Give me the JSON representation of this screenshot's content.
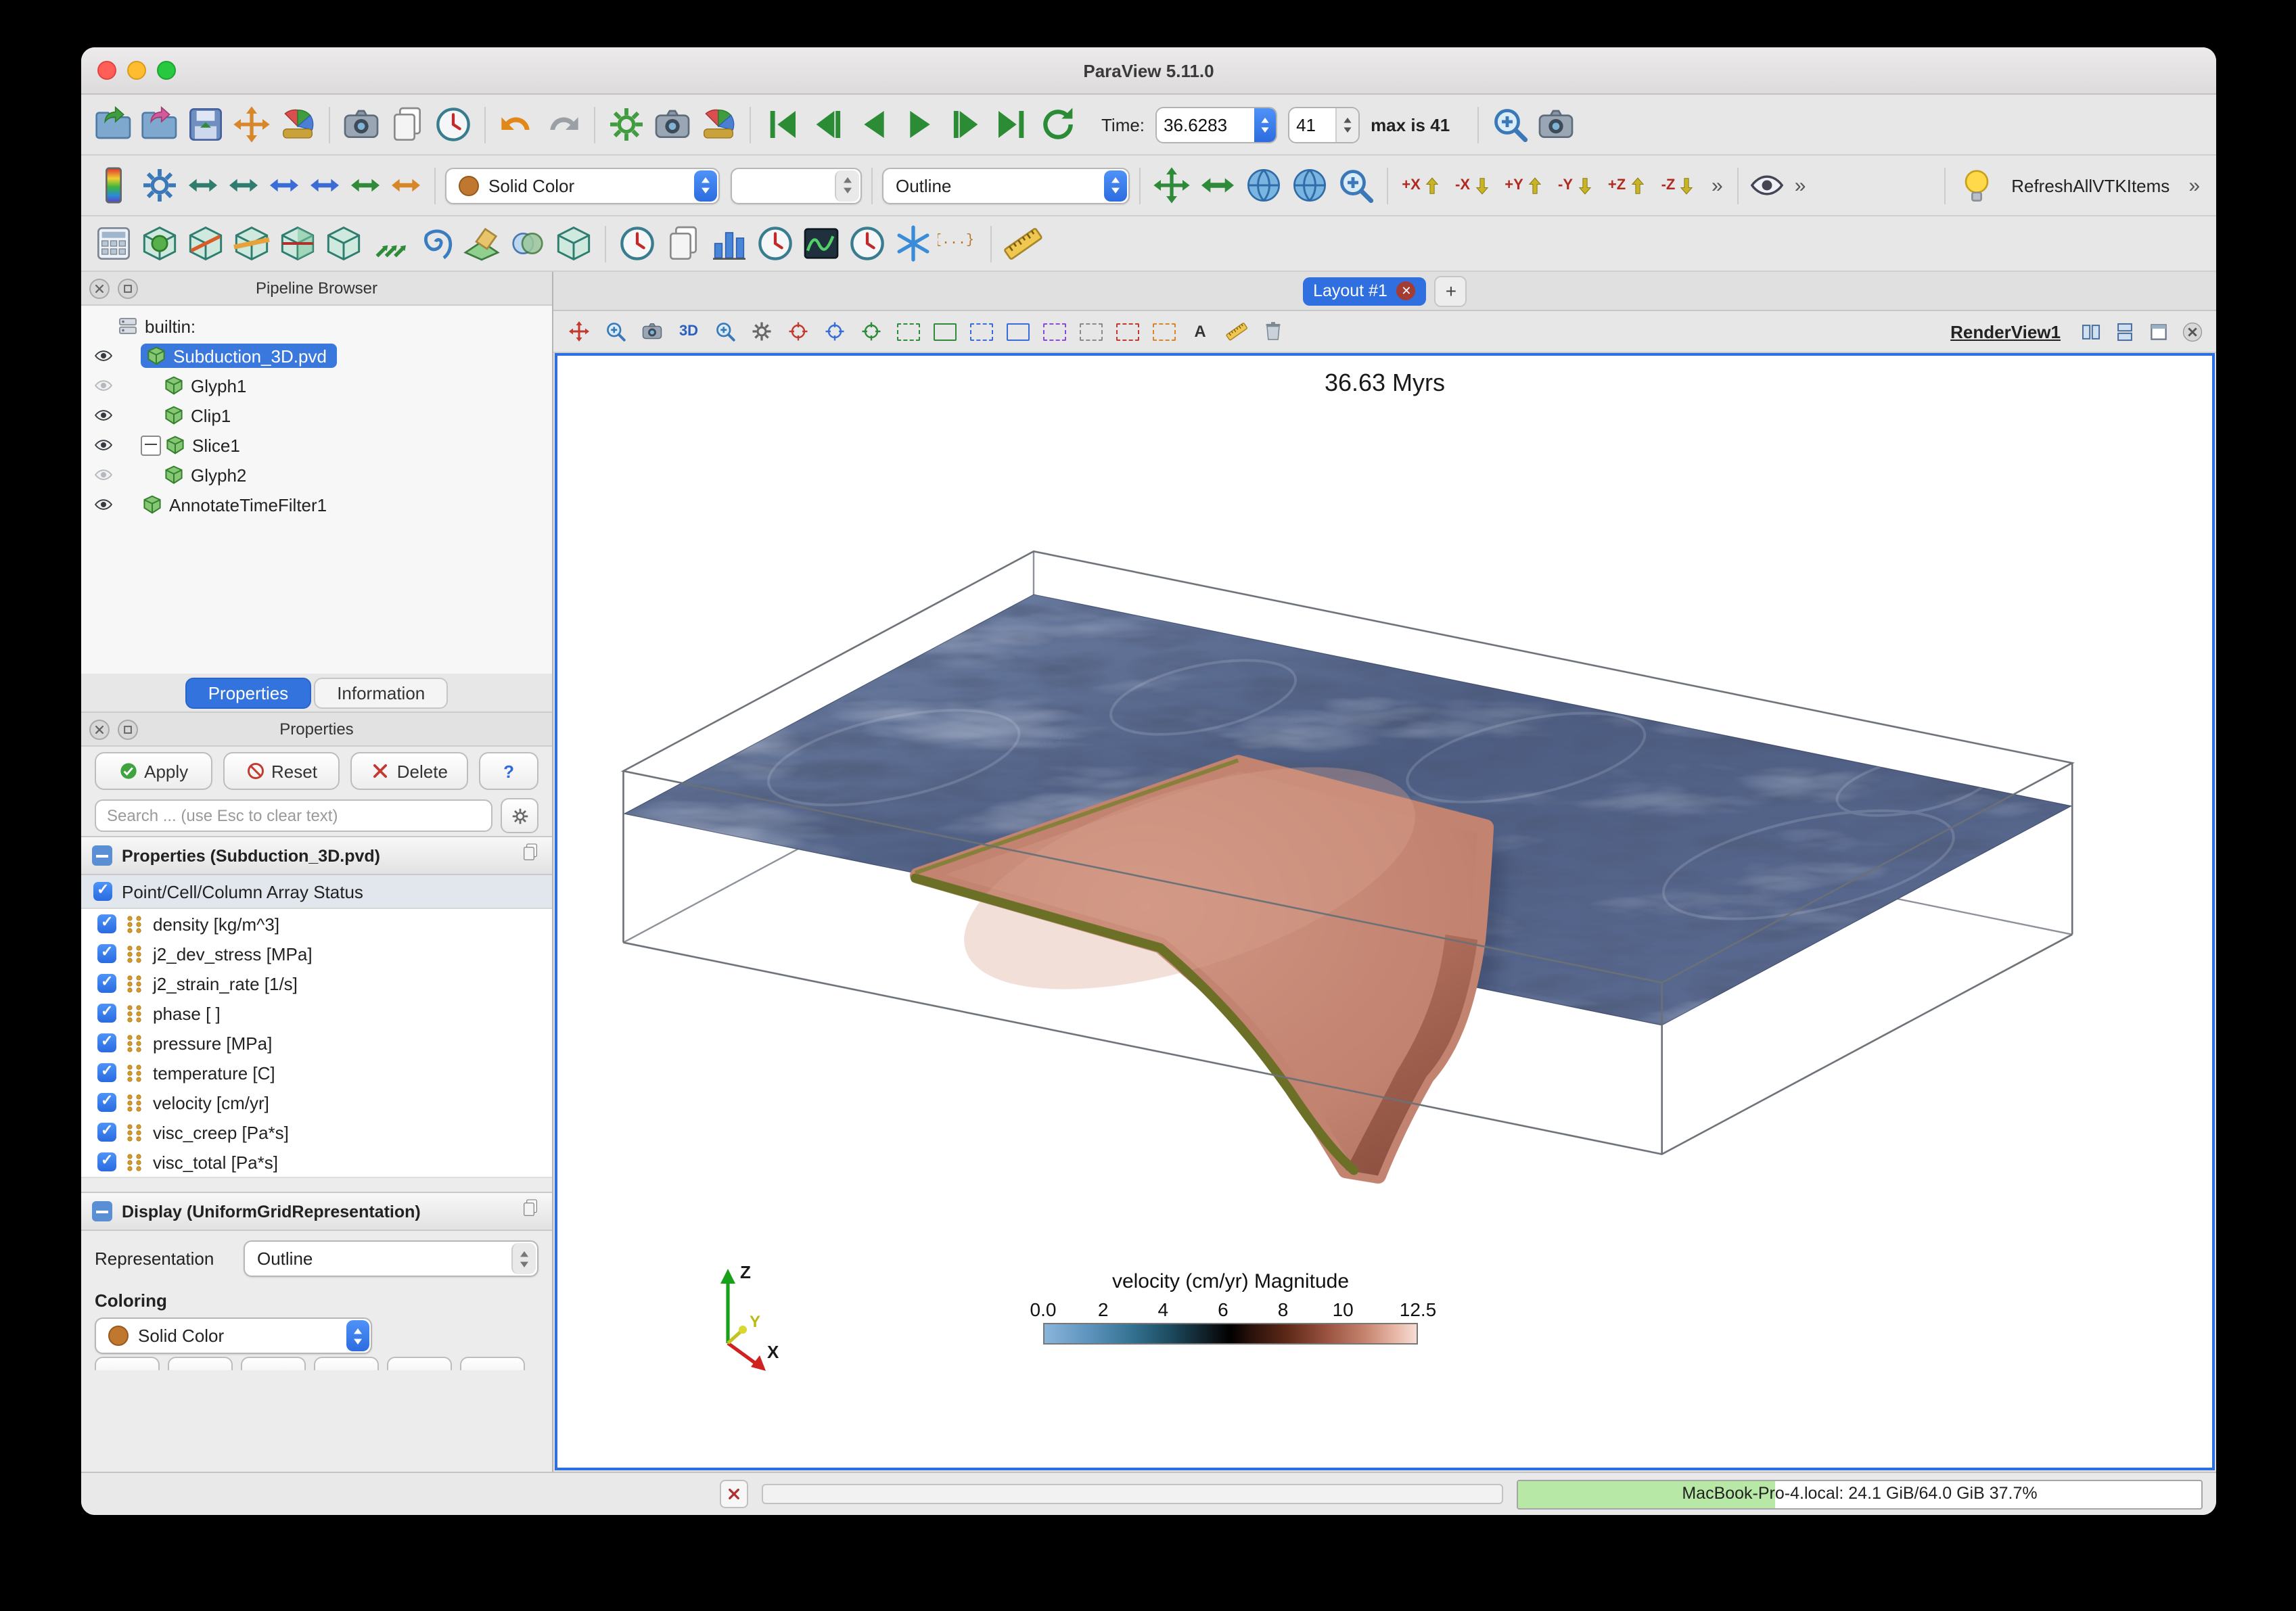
{
  "window": {
    "title": "ParaView 5.11.0"
  },
  "glyphs": {
    "more": "»",
    "plus": "+",
    "close": "✕",
    "help": "?",
    "mode_3d": "3D"
  },
  "toolbar_time": {
    "label": "Time:",
    "time_value": "36.6283",
    "frame_value": "41",
    "max_label": "max is 41"
  },
  "toolbar_color": {
    "colormap_combo": "Solid Color",
    "representation_combo": "Outline",
    "macro_label": "RefreshAllVTKItems",
    "axis_buttons": [
      "+X",
      "-X",
      "+Y",
      "-Y",
      "+Z",
      "-Z"
    ]
  },
  "pipeline": {
    "title": "Pipeline Browser",
    "root_label": "builtin:",
    "items": [
      {
        "label": "Subduction_3D.pvd",
        "selected": true
      },
      {
        "label": "Glyph1"
      },
      {
        "label": "Clip1"
      },
      {
        "label": "Slice1"
      },
      {
        "label": "Glyph2"
      },
      {
        "label": "AnnotateTimeFilter1"
      }
    ]
  },
  "panel_tabs": {
    "properties": "Properties",
    "information": "Information"
  },
  "properties": {
    "title": "Properties",
    "apply_label": "Apply",
    "reset_label": "Reset",
    "delete_label": "Delete",
    "search_placeholder": "Search ... (use Esc to clear text)",
    "section_source": "Properties (Subduction_3D.pvd)",
    "array_header": "Point/Cell/Column Array Status",
    "arrays": [
      "density [kg/m^3]",
      "j2_dev_stress [MPa]",
      "j2_strain_rate [1/s]",
      "phase [ ]",
      "pressure [MPa]",
      "temperature [C]",
      "velocity [cm/yr]",
      "visc_creep [Pa*s]",
      "visc_total [Pa*s]"
    ],
    "section_display": "Display (UniformGridRepresentation)",
    "representation_label": "Representation",
    "representation_value": "Outline",
    "coloring_label": "Coloring",
    "coloring_value": "Solid Color"
  },
  "layout": {
    "tab_label": "Layout #1",
    "view_name": "RenderView1"
  },
  "viewport": {
    "time_annotation": "36.63 Myrs",
    "legend_title": "velocity (cm/yr) Magnitude",
    "legend_ticks": [
      "0.0",
      "2",
      "4",
      "6",
      "8",
      "10",
      "12.5"
    ],
    "axis_x": "X",
    "axis_y": "Y",
    "axis_z": "Z"
  },
  "statusbar": {
    "memory_text": "MacBook-Pro-4.local: 24.1 GiB/64.0 GiB 37.7%"
  },
  "colors": {
    "accent_blue": "#3273de",
    "slab_salmon": "#c28370",
    "slab_edge_olive": "#6c7026",
    "plane_navy": "#55648a",
    "memory_green": "#b7e8a6",
    "legend_gradient": [
      "#8ab5da",
      "#33708f",
      "#0c1216",
      "#5c2818",
      "#9a5340",
      "#c4836e",
      "#f6ddd3"
    ]
  }
}
